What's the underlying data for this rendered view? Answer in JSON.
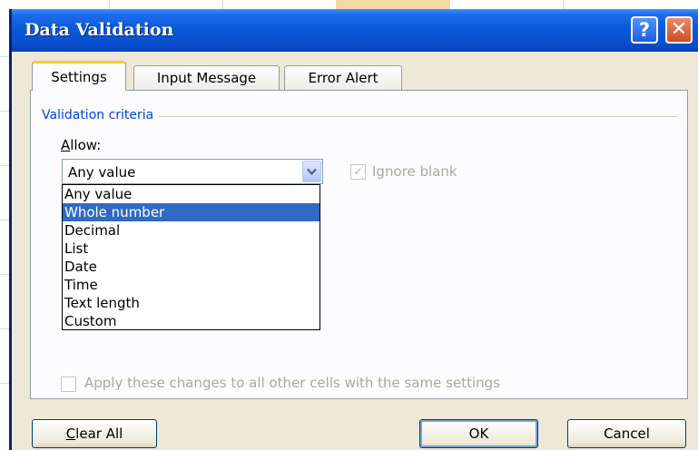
{
  "window": {
    "title": "Data Validation",
    "help_glyph": "?",
    "close_glyph": "✕"
  },
  "tabs": [
    {
      "label": "Settings",
      "active": true
    },
    {
      "label": "Input Message",
      "active": false
    },
    {
      "label": "Error Alert",
      "active": false
    }
  ],
  "settings": {
    "group_label": "Validation criteria",
    "allow_label_accel": "A",
    "allow_label_rest": "llow:",
    "allow_value": "Any value",
    "allow_options": [
      "Any value",
      "Whole number",
      "Decimal",
      "List",
      "Date",
      "Time",
      "Text length",
      "Custom"
    ],
    "highlighted_option": "Whole number",
    "ignore_blank": {
      "label": "Ignore blank",
      "checked": true,
      "enabled": false
    },
    "apply_all": {
      "label": "Apply these changes to all other cells with the same settings",
      "checked": false,
      "enabled": false
    }
  },
  "buttons": {
    "clear_all_accel": "C",
    "clear_all_rest": "lear All",
    "ok": "OK",
    "cancel": "Cancel"
  },
  "colors": {
    "title_bar": "#0a5ad8",
    "selection": "#316ac5",
    "group_label": "#0046d5",
    "active_tab_accent": "#ffc83c",
    "dialog_bg": "#ece9d8"
  }
}
